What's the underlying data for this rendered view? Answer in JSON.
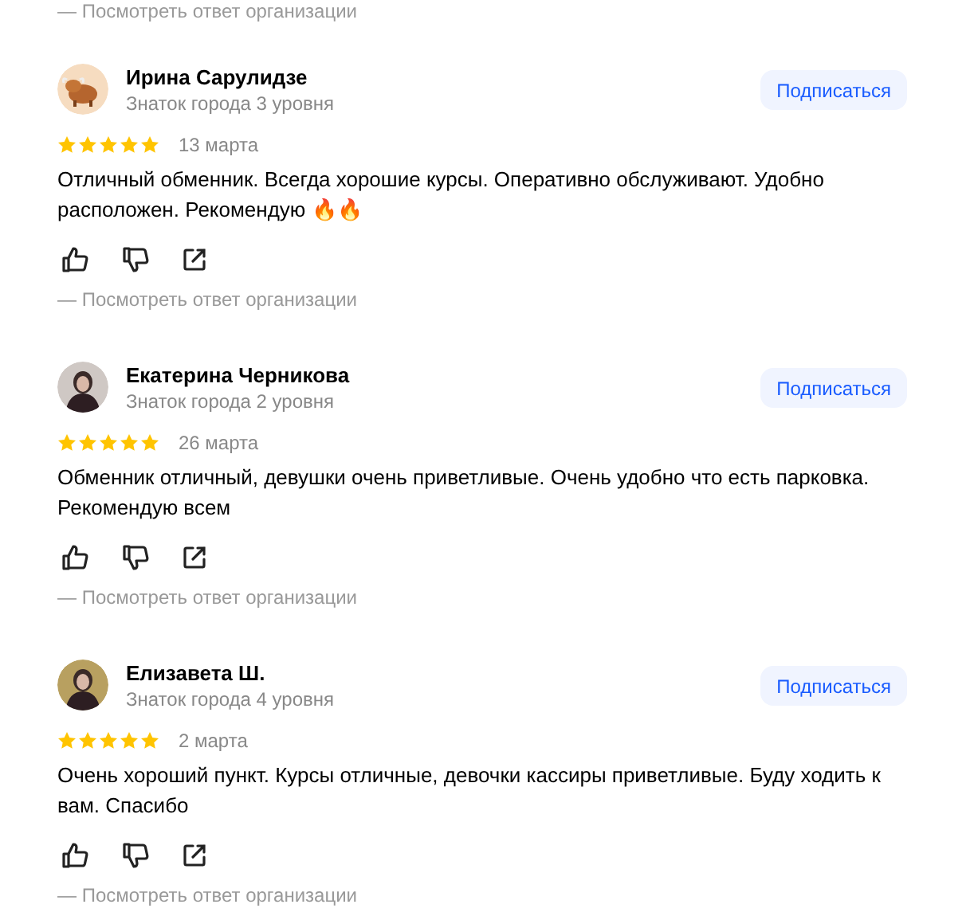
{
  "top_reply_link": "— Посмотреть ответ организации",
  "reviews": [
    {
      "name": "Ирина Сарулидзе",
      "status": "Знаток города 3 уровня",
      "subscribe": "Подписаться",
      "stars": 5,
      "date": "13 марта",
      "text": "Отличный обменник. Всегда хорошие курсы. Оперативно обслуживают. Удобно расположен. Рекомендую 🔥🔥",
      "reply_link": "— Посмотреть ответ организации"
    },
    {
      "name": "Екатерина Черникова",
      "status": "Знаток города 2 уровня",
      "subscribe": "Подписаться",
      "stars": 5,
      "date": "26 марта",
      "text": "Обменник отличный, девушки очень приветливые. Очень удобно что есть парковка. Рекомендую всем",
      "reply_link": "— Посмотреть ответ организации"
    },
    {
      "name": "Елизавета Ш.",
      "status": "Знаток города 4 уровня",
      "subscribe": "Подписаться",
      "stars": 5,
      "date": "2 марта",
      "text": "Очень хороший пункт. Курсы отличные, девочки кассиры приветливые. Буду ходить к вам. Спасибо",
      "reply_link": "— Посмотреть ответ организации"
    }
  ]
}
